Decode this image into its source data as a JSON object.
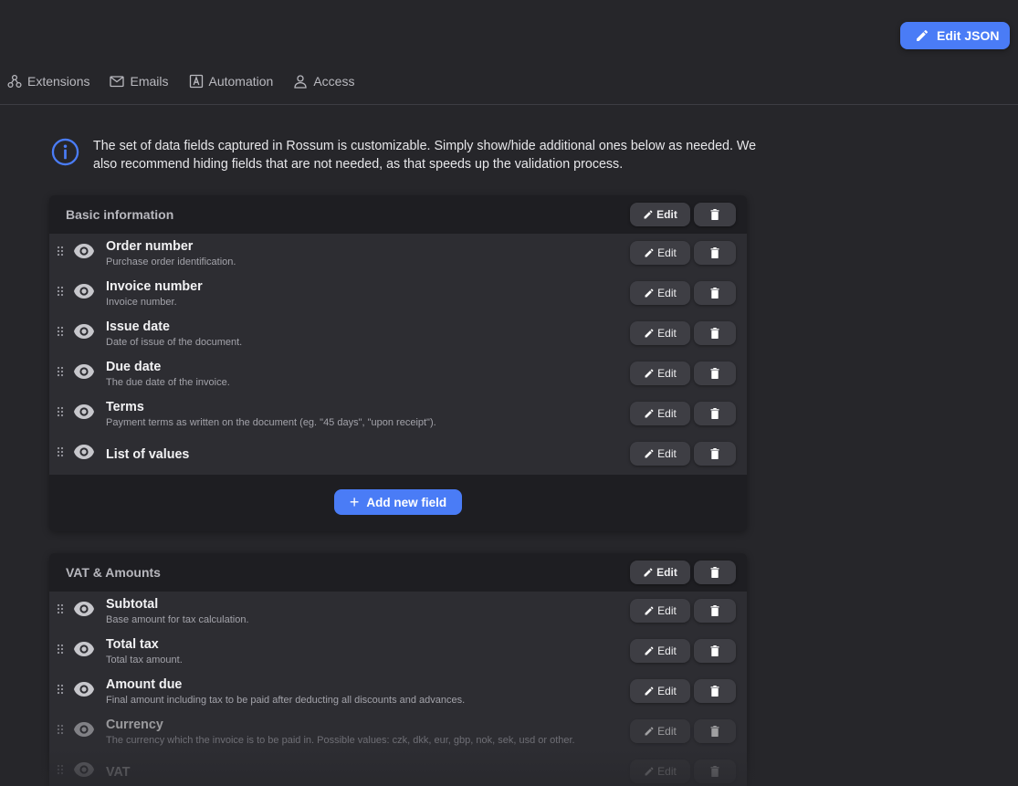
{
  "header": {
    "edit_json_label": "Edit JSON"
  },
  "tabs": [
    {
      "label": "Extensions",
      "icon": "extensions-icon"
    },
    {
      "label": "Emails",
      "icon": "mail-icon"
    },
    {
      "label": "Automation",
      "icon": "automation-icon"
    },
    {
      "label": "Access",
      "icon": "person-icon"
    }
  ],
  "info": {
    "icon": "info-icon",
    "text": "The set of data fields captured in Rossum is customizable. Simply show/hide additional ones below as needed. We also recommend hiding fields that are not needed, as that speeds up the validation process."
  },
  "buttons": {
    "edit_label": "Edit",
    "add_field_label": "Add new field"
  },
  "sections": [
    {
      "title": "Basic information",
      "fields": [
        {
          "name": "Order number",
          "description": "Purchase order identification."
        },
        {
          "name": "Invoice number",
          "description": "Invoice number."
        },
        {
          "name": "Issue date",
          "description": "Date of issue of the document."
        },
        {
          "name": "Due date",
          "description": "The due date of the invoice."
        },
        {
          "name": "Terms",
          "description": "Payment terms as written on the document (eg. \"45 days\", \"upon receipt\")."
        },
        {
          "name": "List of values",
          "description": ""
        }
      ]
    },
    {
      "title": "VAT & Amounts",
      "fields": [
        {
          "name": "Subtotal",
          "description": "Base amount for tax calculation."
        },
        {
          "name": "Total tax",
          "description": "Total tax amount."
        },
        {
          "name": "Amount due",
          "description": "Final amount including tax to be paid after deducting all discounts and advances."
        },
        {
          "name": "Currency",
          "description": "The currency which the invoice is to be paid in. Possible values: czk, dkk, eur, gbp, nok, sek, usd or other."
        },
        {
          "name": "VAT",
          "description": ""
        }
      ]
    }
  ],
  "colors": {
    "accent": "#4a7cf6",
    "background": "#26262a",
    "panel": "#2d2d32"
  }
}
